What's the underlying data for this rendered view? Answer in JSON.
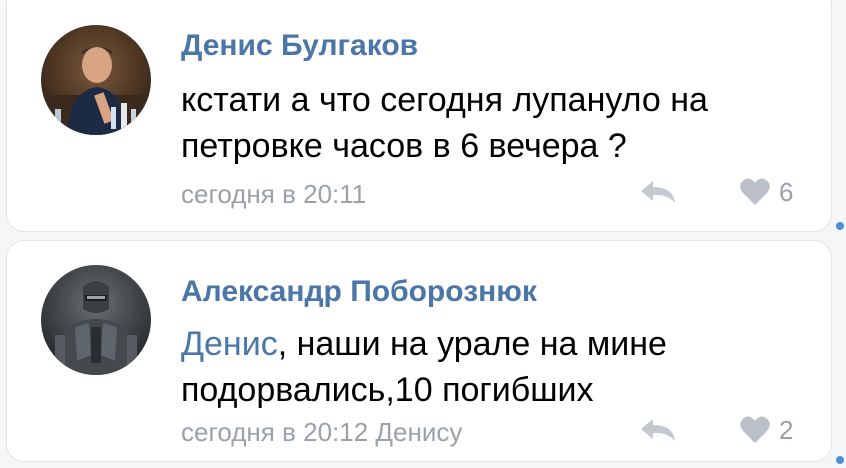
{
  "comments": [
    {
      "author": "Денис Булгаков",
      "text": "кстати а что сегодня лупануло на петровке часов в 6 вечера ?",
      "meta": "сегодня в 20:11",
      "likes": "6"
    },
    {
      "author": "Александр Поборознюк",
      "mention": "Денис",
      "text": ", наши на урале на мине подорвались,10 погибших",
      "meta": "сегодня в 20:12 Денису",
      "likes": "2"
    }
  ],
  "colors": {
    "author": "#4a76a8",
    "meta": "#9aa1aa",
    "text": "#000000"
  }
}
